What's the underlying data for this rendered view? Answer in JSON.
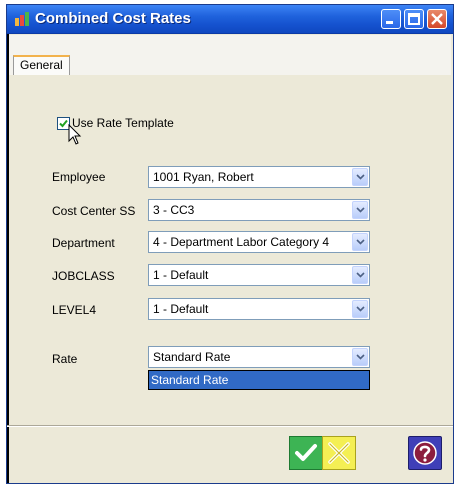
{
  "window": {
    "title": "Combined Cost Rates"
  },
  "tabs": [
    {
      "label": "General"
    }
  ],
  "use_rate_template": {
    "label": "Use Rate Template",
    "checked": true
  },
  "fields": [
    {
      "label": "Employee",
      "value": "1001 Ryan, Robert"
    },
    {
      "label": "Cost Center SS",
      "value": "3 - CC3"
    },
    {
      "label": "Department",
      "value": "4 - Department Labor Category 4"
    },
    {
      "label": "JOBCLASS",
      "value": "1 - Default"
    },
    {
      "label": "LEVEL4",
      "value": "1 - Default"
    },
    {
      "label": "Rate",
      "value": "Standard Rate"
    }
  ],
  "rate_dropdown_options": [
    "Standard Rate"
  ],
  "icons": {
    "app": "app-icon",
    "minimize": "minimize-icon",
    "maximize": "maximize-icon",
    "close": "close-icon",
    "ok": "checkmark-icon",
    "cancel": "x-icon",
    "help": "question-icon"
  },
  "colors": {
    "titlebar": "#1f62dc",
    "selection": "#316ac5",
    "ok": "#3db454",
    "cancel": "#f4ef54",
    "help": "#3f3fb8"
  }
}
